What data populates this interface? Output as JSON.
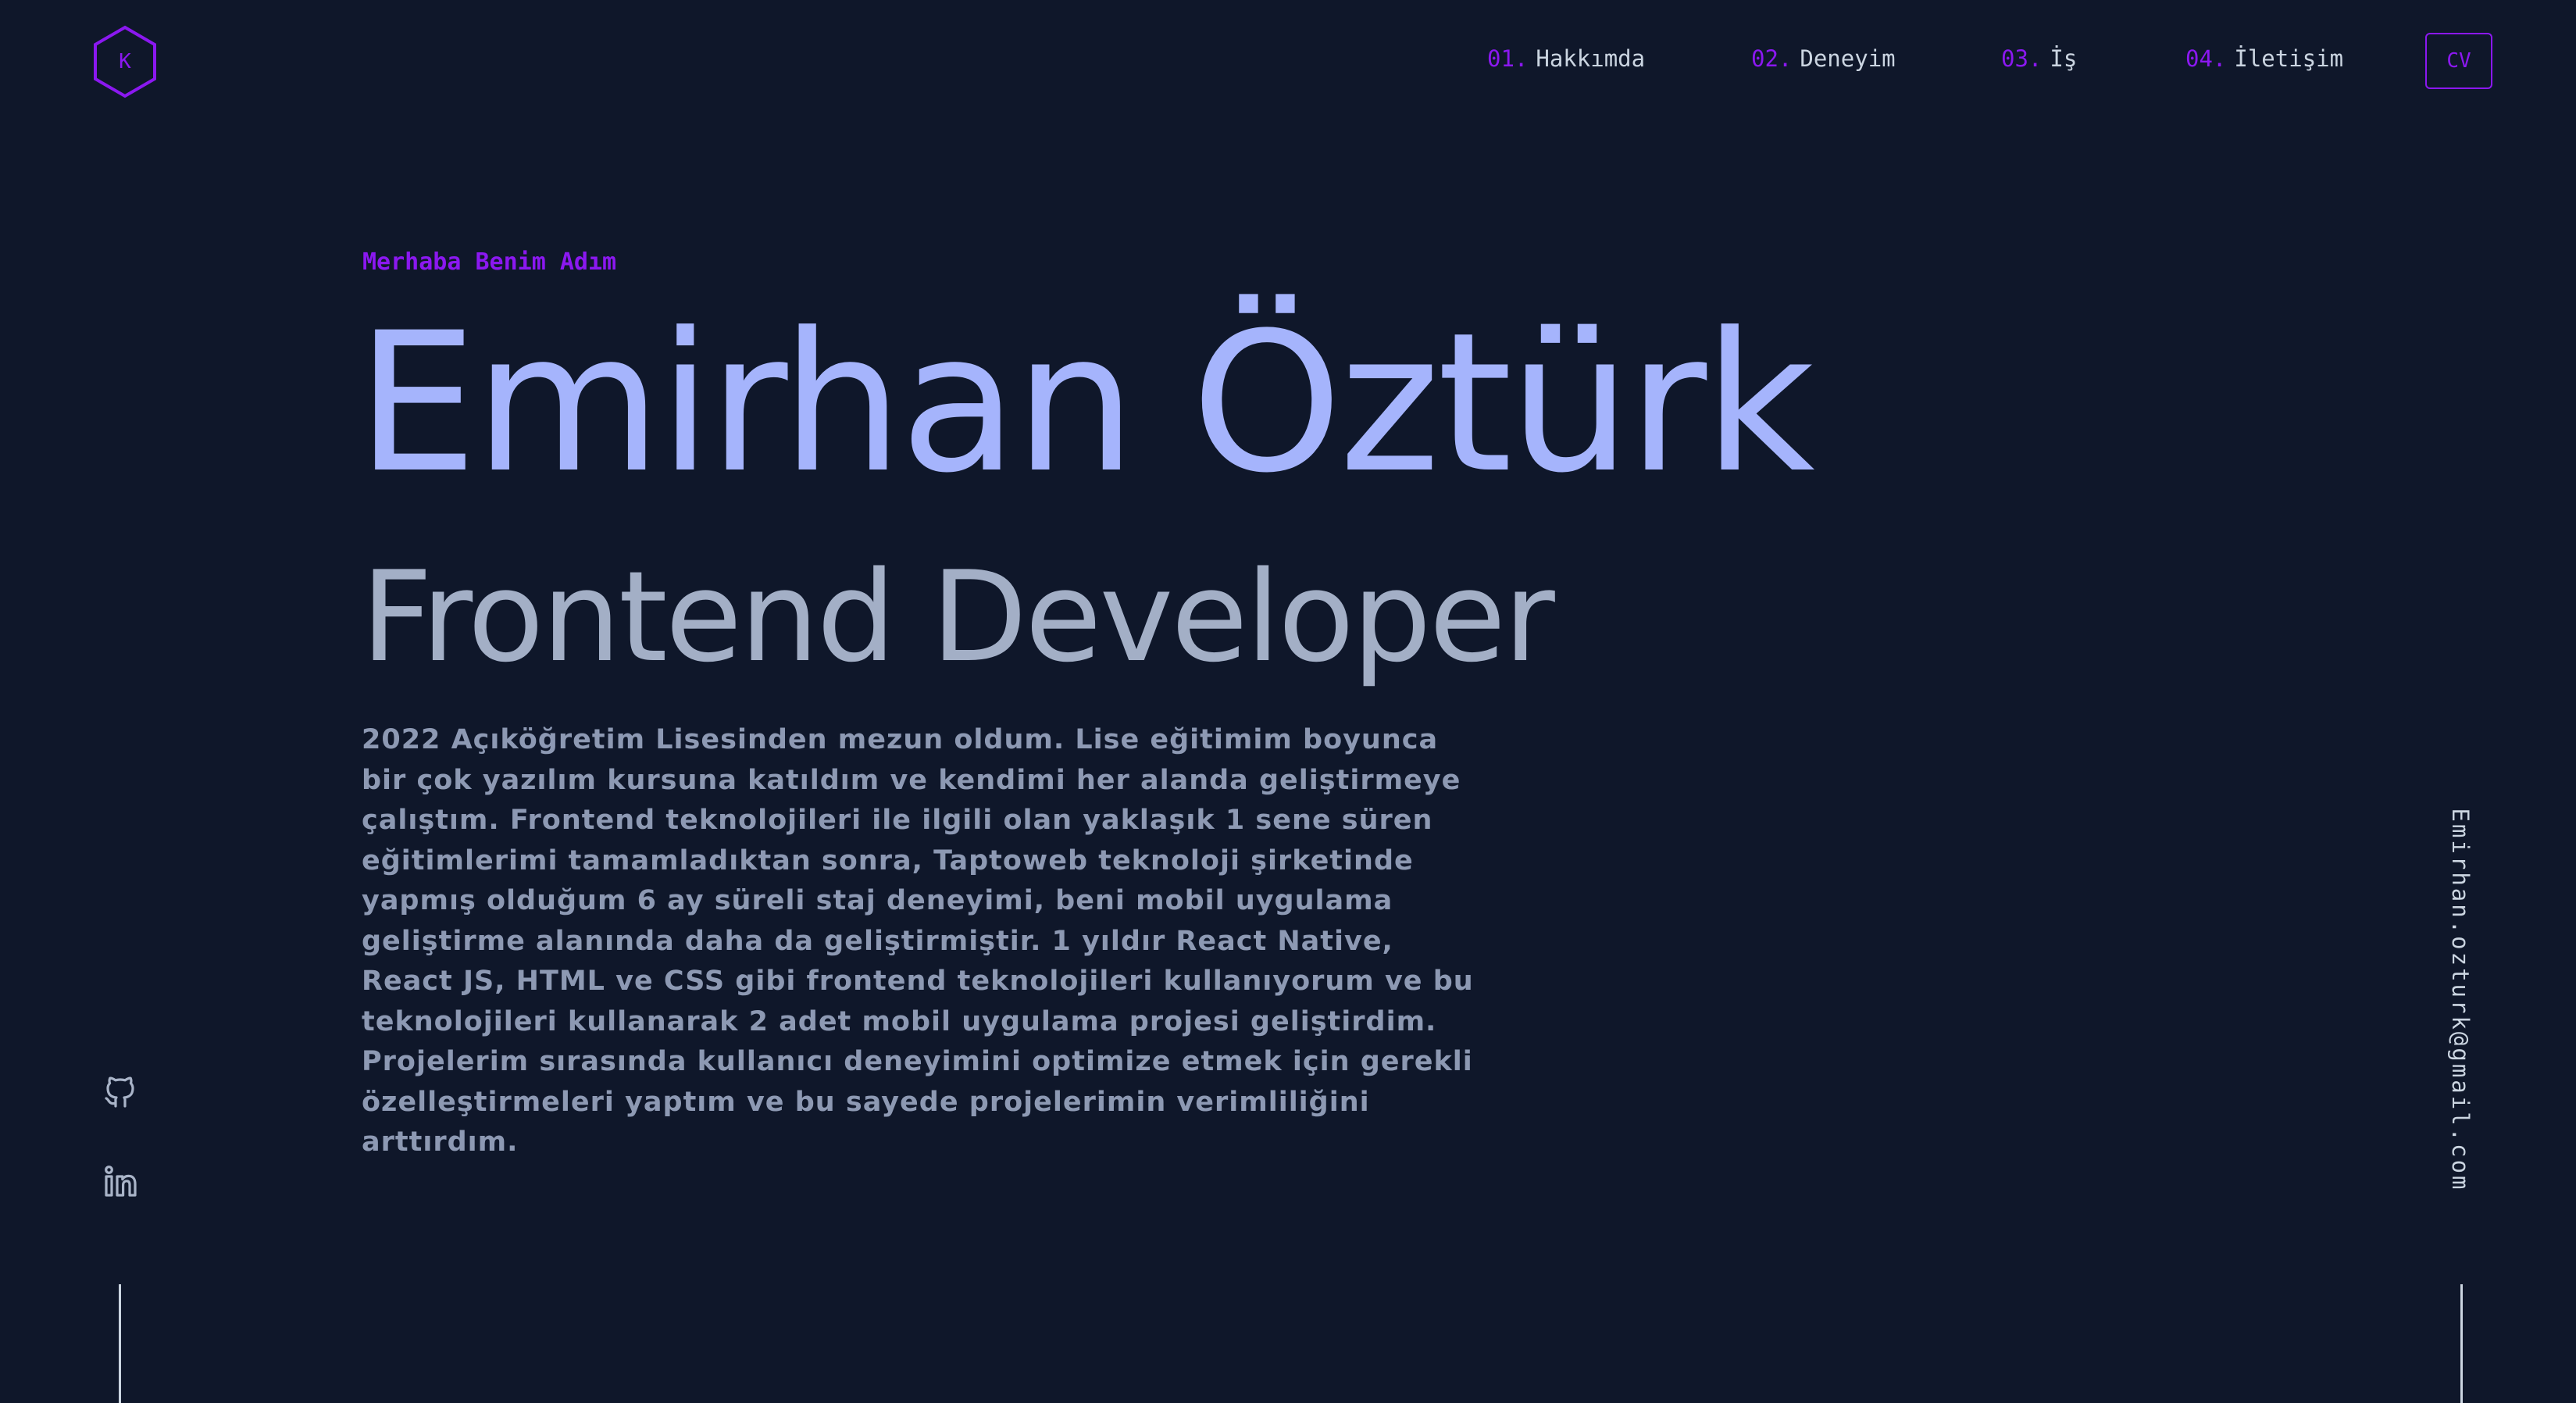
{
  "logo": {
    "letter": "K",
    "icon": "hexagon-logo-icon"
  },
  "nav": {
    "items": [
      {
        "num": "01.",
        "label": "Hakkımda"
      },
      {
        "num": "02.",
        "label": "Deneyim"
      },
      {
        "num": "03.",
        "label": "İş"
      },
      {
        "num": "04.",
        "label": "İletişim"
      }
    ],
    "cv_label": "CV"
  },
  "hero": {
    "greeting": "Merhaba Benim Adım",
    "name": "Emirhan Öztürk",
    "role": "Frontend Developer",
    "description": "2022 Açıköğretim Lisesinden mezun oldum. Lise eğitimim boyunca bir çok yazılım kursuna katıldım ve kendimi her alanda geliştirmeye çalıştım. Frontend teknolojileri ile ilgili olan yaklaşık 1 sene süren eğitimlerimi tamamladıktan sonra, Taptoweb teknoloji şirketinde yapmış olduğum 6 ay süreli staj deneyimi, beni mobil uygulama geliştirme alanında daha da geliştirmiştir. 1 yıldır React Native, React JS, HTML ve CSS gibi frontend teknolojileri kullanıyorum ve bu teknolojileri kullanarak 2 adet mobil uygulama projesi geliştirdim. Projelerim sırasında kullanıcı deneyimini optimize etmek için gerekli özelleştirmeleri yaptım ve bu sayede projelerimin verimliliğini arttırdım."
  },
  "socials": {
    "github_icon": "github-icon",
    "linkedin_icon": "linkedin-icon"
  },
  "email": "Emirhan.ozturk@gmail.com",
  "colors": {
    "background": "#0f172a",
    "accent": "#8b18f0",
    "name": "#a5b4fc",
    "text": "#8d99b3",
    "nav_text": "#cbd5e1"
  }
}
